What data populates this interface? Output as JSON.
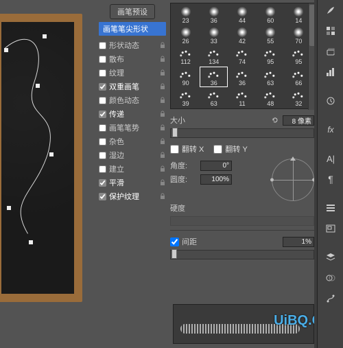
{
  "presets_btn": "画笔预设",
  "tip_shape": "画笔笔尖形状",
  "options": [
    {
      "label": "形状动态",
      "checked": false,
      "locked": true
    },
    {
      "label": "散布",
      "checked": false,
      "locked": true
    },
    {
      "label": "纹理",
      "checked": false,
      "locked": true
    },
    {
      "label": "双重画笔",
      "checked": true,
      "locked": true
    },
    {
      "label": "颜色动态",
      "checked": false,
      "locked": true
    },
    {
      "label": "传递",
      "checked": true,
      "locked": true
    },
    {
      "label": "画笔笔势",
      "checked": false,
      "locked": true
    },
    {
      "label": "杂色",
      "checked": false,
      "locked": true
    },
    {
      "label": "湿边",
      "checked": false,
      "locked": true
    },
    {
      "label": "建立",
      "checked": false,
      "locked": true
    },
    {
      "label": "平滑",
      "checked": true,
      "locked": true
    },
    {
      "label": "保护纹理",
      "checked": true,
      "locked": true
    }
  ],
  "thumbs": [
    [
      23,
      36,
      44,
      60,
      14
    ],
    [
      26,
      33,
      42,
      55,
      70
    ],
    [
      112,
      134,
      74,
      95,
      95
    ],
    [
      90,
      36,
      36,
      63,
      66
    ],
    [
      39,
      63,
      11,
      48,
      32
    ]
  ],
  "selected_thumb": {
    "row": 3,
    "col": 1
  },
  "size": {
    "label": "大小",
    "value": "8 像素"
  },
  "flipx": {
    "label": "翻转 X",
    "checked": false
  },
  "flipy": {
    "label": "翻转 Y",
    "checked": false
  },
  "angle": {
    "label": "角度:",
    "value": "0°"
  },
  "roundness": {
    "label": "圆度:",
    "value": "100%"
  },
  "hardness": {
    "label": "硬度"
  },
  "spacing": {
    "label": "间距",
    "checked": true,
    "value": "1%"
  },
  "watermark": "UiBQ.CoM"
}
